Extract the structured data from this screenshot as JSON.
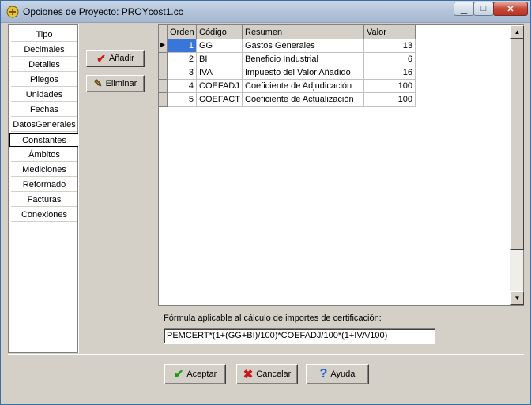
{
  "window": {
    "title": "Opciones de Proyecto: PROYcost1.cc"
  },
  "tabs": [
    "Tipo",
    "Decimales",
    "Detalles",
    "Pliegos",
    "Unidades",
    "Fechas",
    "DatosGenerales",
    "Constantes",
    "Ámbitos",
    "Mediciones",
    "Reformado",
    "Facturas",
    "Conexiones"
  ],
  "active_tab": "Constantes",
  "side_buttons": {
    "add": "Añadir",
    "delete": "Eliminar"
  },
  "grid": {
    "headers": {
      "orden": "Orden",
      "codigo": "Código",
      "resumen": "Resumen",
      "valor": "Valor"
    },
    "rows": [
      {
        "orden": "1",
        "codigo": "GG",
        "resumen": "Gastos Generales",
        "valor": "13"
      },
      {
        "orden": "2",
        "codigo": "BI",
        "resumen": "Beneficio Industrial",
        "valor": "6"
      },
      {
        "orden": "3",
        "codigo": "IVA",
        "resumen": "Impuesto del Valor Añadido",
        "valor": "16"
      },
      {
        "orden": "4",
        "codigo": "COEFADJ",
        "resumen": "Coeficiente de Adjudicación",
        "valor": "100"
      },
      {
        "orden": "5",
        "codigo": "COEFACT",
        "resumen": "Coeficiente de Actualización",
        "valor": "100"
      }
    ]
  },
  "formula": {
    "label": "Fórmula aplicable al cálculo de importes de certificación:",
    "value": "PEMCERT*(1+(GG+BI)/100)*COEFADJ/100*(1+IVA/100)"
  },
  "footer_buttons": {
    "accept": "Aceptar",
    "cancel": "Cancelar",
    "help": "Ayuda"
  },
  "colors": {
    "selection": "#3a76d8",
    "accept_icon": "#1a9a1a",
    "cancel_icon": "#c81818",
    "help_icon": "#1a5fd0"
  }
}
